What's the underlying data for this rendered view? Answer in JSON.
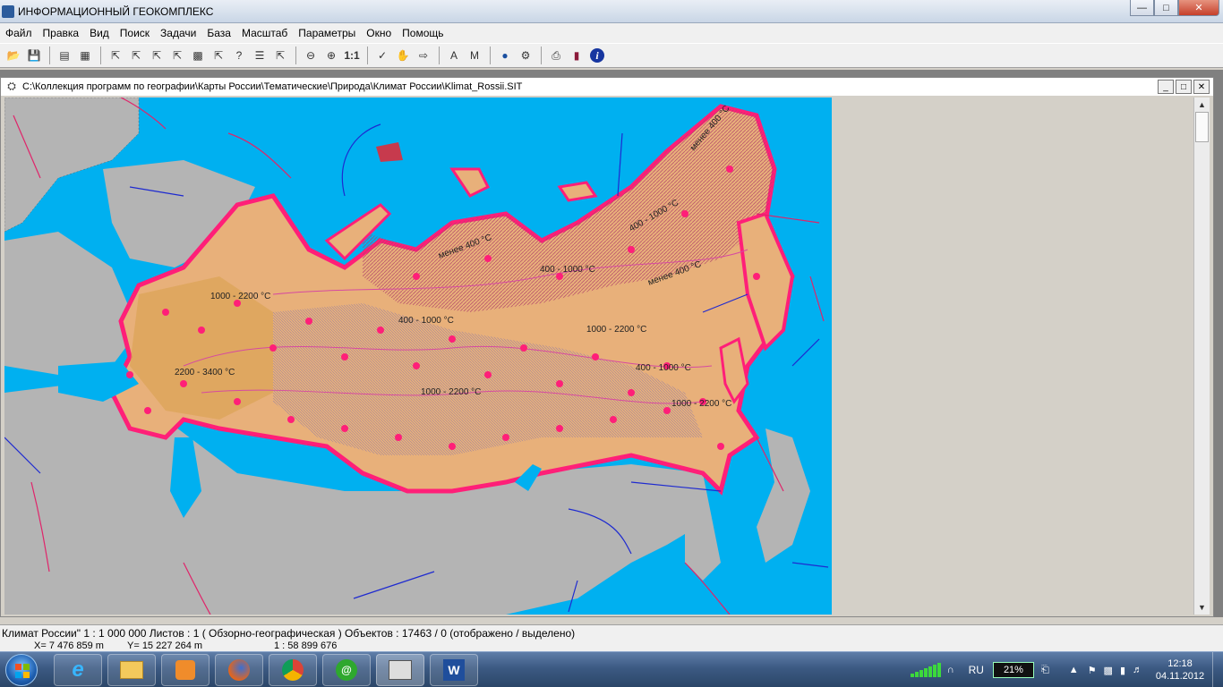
{
  "window": {
    "title": "ИНФОРМАЦИОННЫЙ ГЕОКОМПЛЕКС"
  },
  "menu": [
    "Файл",
    "Правка",
    "Вид",
    "Поиск",
    "Задачи",
    "База",
    "Масштаб",
    "Параметры",
    "Окно",
    "Помощь"
  ],
  "toolbar": {
    "scale_one": "1:1",
    "icons": [
      "open-icon",
      "save-icon",
      "layers-icon",
      "print-preview-icon",
      "select-icon",
      "select-text-icon",
      "select-area-icon",
      "select-filter-icon",
      "select-rect-icon",
      "add-object-icon",
      "query-icon",
      "list-icon",
      "clear-select-icon",
      "zoom-out-icon",
      "zoom-in-icon",
      "zoom-1to1-icon",
      "check-icon",
      "hand-icon",
      "move-icon",
      "text-icon",
      "measure-icon",
      "globe-icon",
      "settings-icon",
      "printer-icon",
      "book-icon",
      "info-icon"
    ]
  },
  "document": {
    "path": "C:\\Коллекция программ по географии\\Карты России\\Тематические\\Природа\\Климат России\\Klimat_Rossii.SIT"
  },
  "map": {
    "labels": [
      "1000 - 2200 °C",
      "400 - 1000 °C",
      "1000 - 2200 °C",
      "2200 - 3400 °C",
      "1000 - 2200 °C",
      "400 - 1000 °C",
      "1000 - 2200 °C",
      "400 - 1000 °C",
      "менее 400 °C",
      "менее 400 °C",
      "менее 400 °C",
      "400 - 1000 °C"
    ],
    "colors": {
      "sea": "#00b0f0",
      "land": "#b4b4b4",
      "russia": "#e8b07a",
      "border": "#ff1f78",
      "wind_blue": "#1e2ad0",
      "wind_pink": "#e0246a"
    }
  },
  "status": {
    "text": "Климат России\"  1 : 1 000 000   Листов : 1   ( Обзорно-географическая )  Объектов : 17463 / 0 (отображено / выделено)",
    "x": "X=  7 476 859 m",
    "y": "Y=  15 227 264 m",
    "scale": "1 : 58 899 676"
  },
  "taskbar": {
    "lang": "RU",
    "battery": "21%",
    "time": "12:18",
    "date": "04.11.2012",
    "apps": [
      "ie-icon",
      "explorer-icon",
      "media-player-icon",
      "firefox-icon",
      "chrome-icon",
      "mail-agent-icon",
      "geocomplex-icon",
      "word-icon"
    ]
  }
}
